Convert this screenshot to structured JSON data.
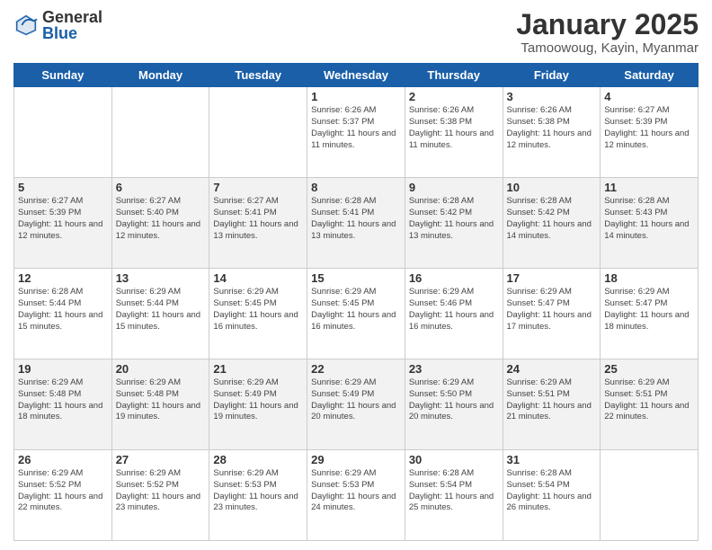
{
  "logo": {
    "general": "General",
    "blue": "Blue"
  },
  "header": {
    "month": "January 2025",
    "location": "Tamoowoug, Kayin, Myanmar"
  },
  "weekdays": [
    "Sunday",
    "Monday",
    "Tuesday",
    "Wednesday",
    "Thursday",
    "Friday",
    "Saturday"
  ],
  "weeks": [
    [
      {
        "day": "",
        "sunrise": "",
        "sunset": "",
        "daylight": ""
      },
      {
        "day": "",
        "sunrise": "",
        "sunset": "",
        "daylight": ""
      },
      {
        "day": "",
        "sunrise": "",
        "sunset": "",
        "daylight": ""
      },
      {
        "day": "1",
        "sunrise": "Sunrise: 6:26 AM",
        "sunset": "Sunset: 5:37 PM",
        "daylight": "Daylight: 11 hours and 11 minutes."
      },
      {
        "day": "2",
        "sunrise": "Sunrise: 6:26 AM",
        "sunset": "Sunset: 5:38 PM",
        "daylight": "Daylight: 11 hours and 11 minutes."
      },
      {
        "day": "3",
        "sunrise": "Sunrise: 6:26 AM",
        "sunset": "Sunset: 5:38 PM",
        "daylight": "Daylight: 11 hours and 12 minutes."
      },
      {
        "day": "4",
        "sunrise": "Sunrise: 6:27 AM",
        "sunset": "Sunset: 5:39 PM",
        "daylight": "Daylight: 11 hours and 12 minutes."
      }
    ],
    [
      {
        "day": "5",
        "sunrise": "Sunrise: 6:27 AM",
        "sunset": "Sunset: 5:39 PM",
        "daylight": "Daylight: 11 hours and 12 minutes."
      },
      {
        "day": "6",
        "sunrise": "Sunrise: 6:27 AM",
        "sunset": "Sunset: 5:40 PM",
        "daylight": "Daylight: 11 hours and 12 minutes."
      },
      {
        "day": "7",
        "sunrise": "Sunrise: 6:27 AM",
        "sunset": "Sunset: 5:41 PM",
        "daylight": "Daylight: 11 hours and 13 minutes."
      },
      {
        "day": "8",
        "sunrise": "Sunrise: 6:28 AM",
        "sunset": "Sunset: 5:41 PM",
        "daylight": "Daylight: 11 hours and 13 minutes."
      },
      {
        "day": "9",
        "sunrise": "Sunrise: 6:28 AM",
        "sunset": "Sunset: 5:42 PM",
        "daylight": "Daylight: 11 hours and 13 minutes."
      },
      {
        "day": "10",
        "sunrise": "Sunrise: 6:28 AM",
        "sunset": "Sunset: 5:42 PM",
        "daylight": "Daylight: 11 hours and 14 minutes."
      },
      {
        "day": "11",
        "sunrise": "Sunrise: 6:28 AM",
        "sunset": "Sunset: 5:43 PM",
        "daylight": "Daylight: 11 hours and 14 minutes."
      }
    ],
    [
      {
        "day": "12",
        "sunrise": "Sunrise: 6:28 AM",
        "sunset": "Sunset: 5:44 PM",
        "daylight": "Daylight: 11 hours and 15 minutes."
      },
      {
        "day": "13",
        "sunrise": "Sunrise: 6:29 AM",
        "sunset": "Sunset: 5:44 PM",
        "daylight": "Daylight: 11 hours and 15 minutes."
      },
      {
        "day": "14",
        "sunrise": "Sunrise: 6:29 AM",
        "sunset": "Sunset: 5:45 PM",
        "daylight": "Daylight: 11 hours and 16 minutes."
      },
      {
        "day": "15",
        "sunrise": "Sunrise: 6:29 AM",
        "sunset": "Sunset: 5:45 PM",
        "daylight": "Daylight: 11 hours and 16 minutes."
      },
      {
        "day": "16",
        "sunrise": "Sunrise: 6:29 AM",
        "sunset": "Sunset: 5:46 PM",
        "daylight": "Daylight: 11 hours and 16 minutes."
      },
      {
        "day": "17",
        "sunrise": "Sunrise: 6:29 AM",
        "sunset": "Sunset: 5:47 PM",
        "daylight": "Daylight: 11 hours and 17 minutes."
      },
      {
        "day": "18",
        "sunrise": "Sunrise: 6:29 AM",
        "sunset": "Sunset: 5:47 PM",
        "daylight": "Daylight: 11 hours and 18 minutes."
      }
    ],
    [
      {
        "day": "19",
        "sunrise": "Sunrise: 6:29 AM",
        "sunset": "Sunset: 5:48 PM",
        "daylight": "Daylight: 11 hours and 18 minutes."
      },
      {
        "day": "20",
        "sunrise": "Sunrise: 6:29 AM",
        "sunset": "Sunset: 5:48 PM",
        "daylight": "Daylight: 11 hours and 19 minutes."
      },
      {
        "day": "21",
        "sunrise": "Sunrise: 6:29 AM",
        "sunset": "Sunset: 5:49 PM",
        "daylight": "Daylight: 11 hours and 19 minutes."
      },
      {
        "day": "22",
        "sunrise": "Sunrise: 6:29 AM",
        "sunset": "Sunset: 5:49 PM",
        "daylight": "Daylight: 11 hours and 20 minutes."
      },
      {
        "day": "23",
        "sunrise": "Sunrise: 6:29 AM",
        "sunset": "Sunset: 5:50 PM",
        "daylight": "Daylight: 11 hours and 20 minutes."
      },
      {
        "day": "24",
        "sunrise": "Sunrise: 6:29 AM",
        "sunset": "Sunset: 5:51 PM",
        "daylight": "Daylight: 11 hours and 21 minutes."
      },
      {
        "day": "25",
        "sunrise": "Sunrise: 6:29 AM",
        "sunset": "Sunset: 5:51 PM",
        "daylight": "Daylight: 11 hours and 22 minutes."
      }
    ],
    [
      {
        "day": "26",
        "sunrise": "Sunrise: 6:29 AM",
        "sunset": "Sunset: 5:52 PM",
        "daylight": "Daylight: 11 hours and 22 minutes."
      },
      {
        "day": "27",
        "sunrise": "Sunrise: 6:29 AM",
        "sunset": "Sunset: 5:52 PM",
        "daylight": "Daylight: 11 hours and 23 minutes."
      },
      {
        "day": "28",
        "sunrise": "Sunrise: 6:29 AM",
        "sunset": "Sunset: 5:53 PM",
        "daylight": "Daylight: 11 hours and 23 minutes."
      },
      {
        "day": "29",
        "sunrise": "Sunrise: 6:29 AM",
        "sunset": "Sunset: 5:53 PM",
        "daylight": "Daylight: 11 hours and 24 minutes."
      },
      {
        "day": "30",
        "sunrise": "Sunrise: 6:28 AM",
        "sunset": "Sunset: 5:54 PM",
        "daylight": "Daylight: 11 hours and 25 minutes."
      },
      {
        "day": "31",
        "sunrise": "Sunrise: 6:28 AM",
        "sunset": "Sunset: 5:54 PM",
        "daylight": "Daylight: 11 hours and 26 minutes."
      },
      {
        "day": "",
        "sunrise": "",
        "sunset": "",
        "daylight": ""
      }
    ]
  ]
}
